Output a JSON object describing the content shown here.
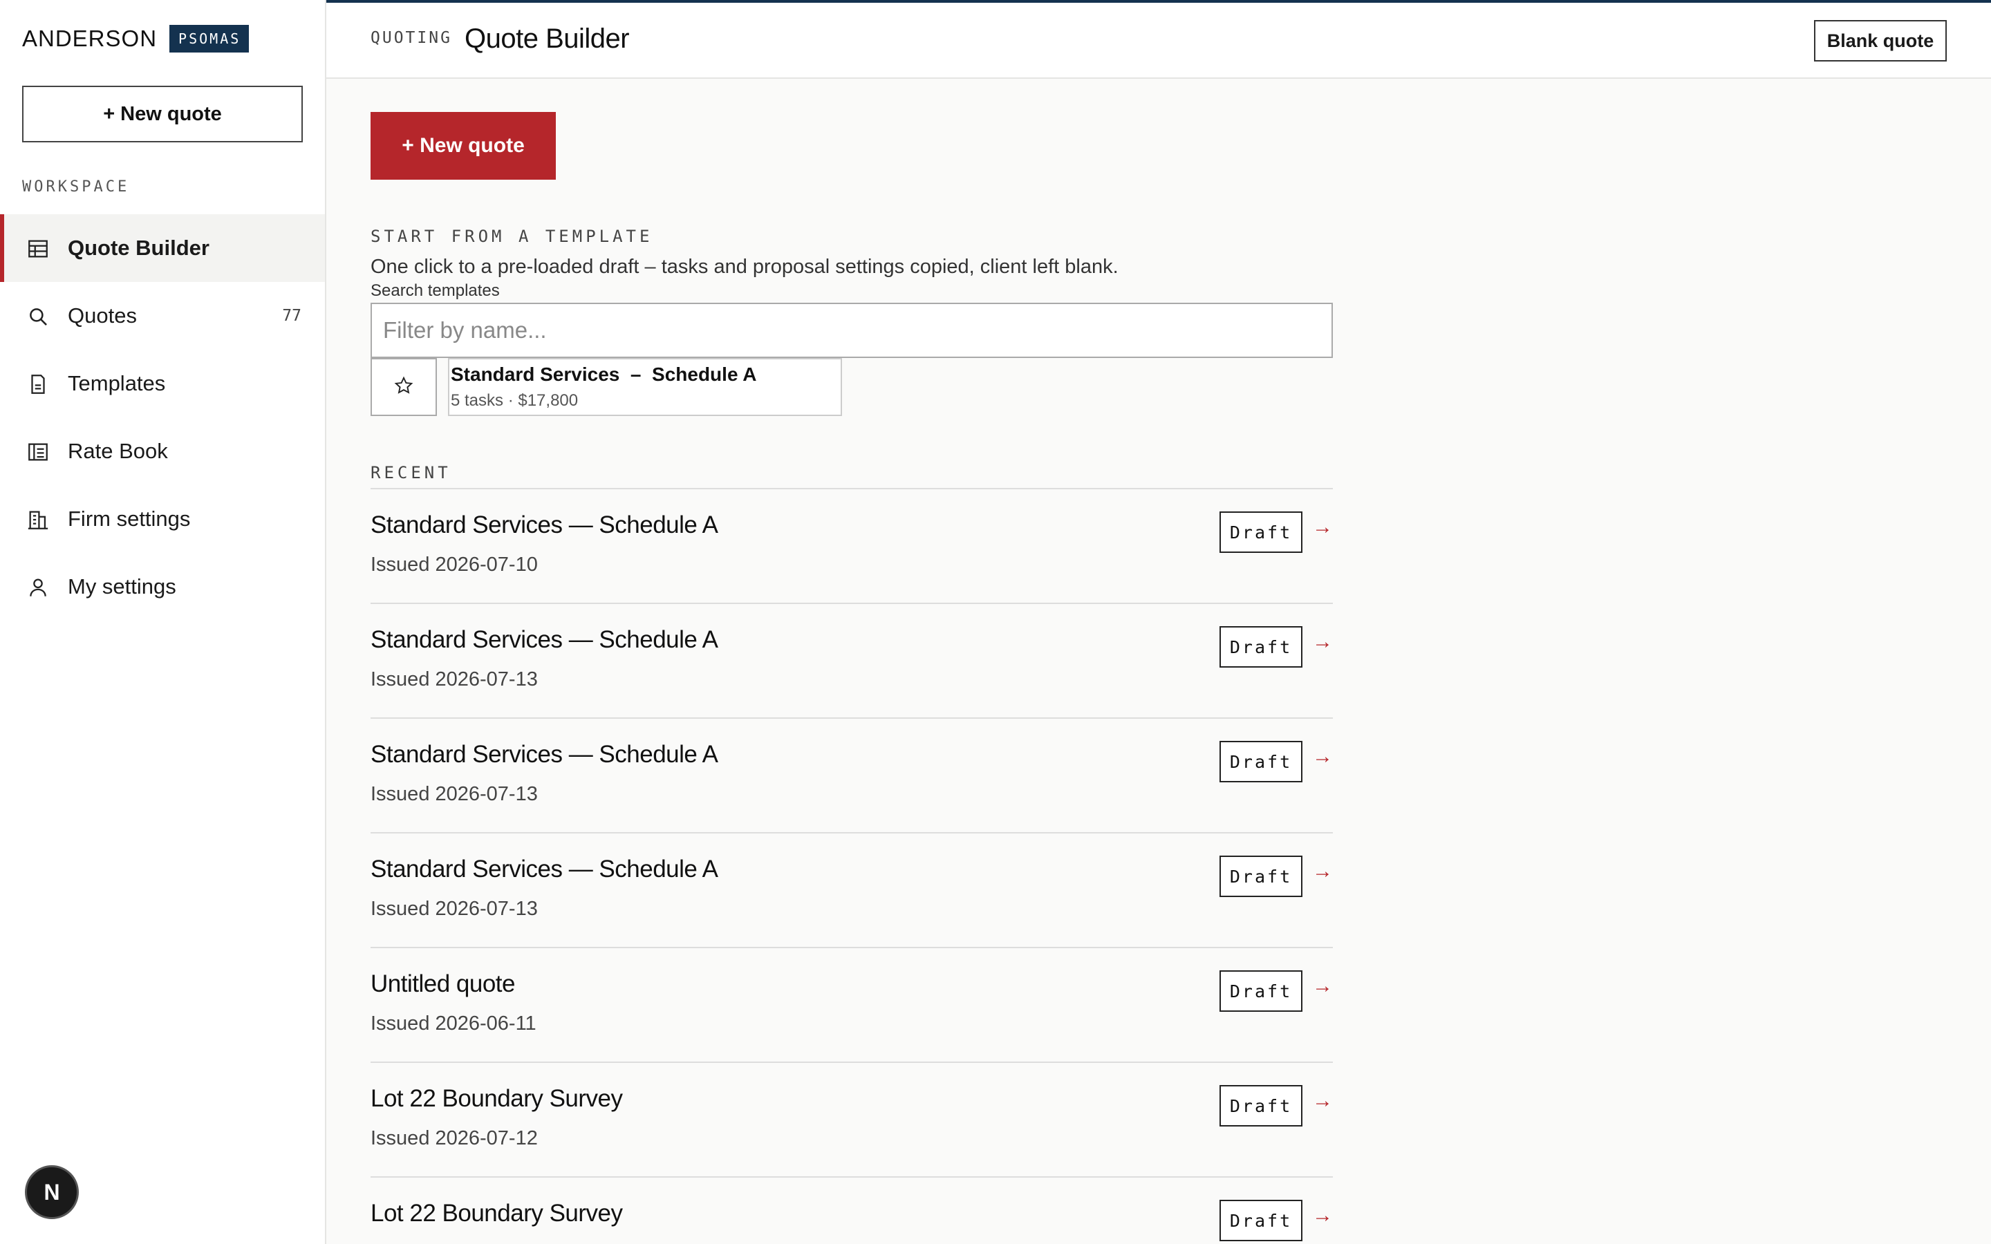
{
  "brand": {
    "name": "ANDERSON",
    "badge": "PSOMAS"
  },
  "sidebar": {
    "new_quote_label": "+ New quote",
    "section_label": "WORKSPACE",
    "items": [
      {
        "label": "Quote Builder",
        "icon": "table-icon",
        "active": true
      },
      {
        "label": "Quotes",
        "icon": "search-icon",
        "count": "77"
      },
      {
        "label": "Templates",
        "icon": "document-icon"
      },
      {
        "label": "Rate Book",
        "icon": "book-table-icon"
      },
      {
        "label": "Firm settings",
        "icon": "building-icon"
      },
      {
        "label": "My settings",
        "icon": "user-icon"
      }
    ],
    "avatar_initial": "N"
  },
  "header": {
    "breadcrumb": "QUOTING",
    "title": "Quote Builder",
    "blank_quote_label": "Blank quote"
  },
  "main": {
    "new_quote_label": "+ New quote",
    "templates": {
      "section_label": "START FROM A TEMPLATE",
      "description": "One click to a pre-loaded draft  –  tasks and proposal settings copied, client left blank.",
      "search_label": "Search templates",
      "search_placeholder": "Filter by name...",
      "items": [
        {
          "title": "Standard Services  –  Schedule A",
          "meta": "5 tasks · $17,800"
        }
      ]
    },
    "recent": {
      "section_label": "RECENT",
      "items": [
        {
          "title": "Standard Services — Schedule A",
          "issued": "Issued 2026-07-10",
          "status": "Draft"
        },
        {
          "title": "Standard Services — Schedule A",
          "issued": "Issued 2026-07-13",
          "status": "Draft"
        },
        {
          "title": "Standard Services — Schedule A",
          "issued": "Issued 2026-07-13",
          "status": "Draft"
        },
        {
          "title": "Standard Services — Schedule A",
          "issued": "Issued 2026-07-13",
          "status": "Draft"
        },
        {
          "title": "Untitled quote",
          "issued": "Issued 2026-06-11",
          "status": "Draft"
        },
        {
          "title": "Lot 22 Boundary Survey",
          "issued": "Issued 2026-07-12",
          "status": "Draft"
        },
        {
          "title": "Lot 22 Boundary Survey",
          "issued": "",
          "status": "Draft"
        }
      ],
      "arrow_glyph": "→"
    }
  },
  "colors": {
    "accent": "#b5262b",
    "brand_navy": "#14324f"
  }
}
